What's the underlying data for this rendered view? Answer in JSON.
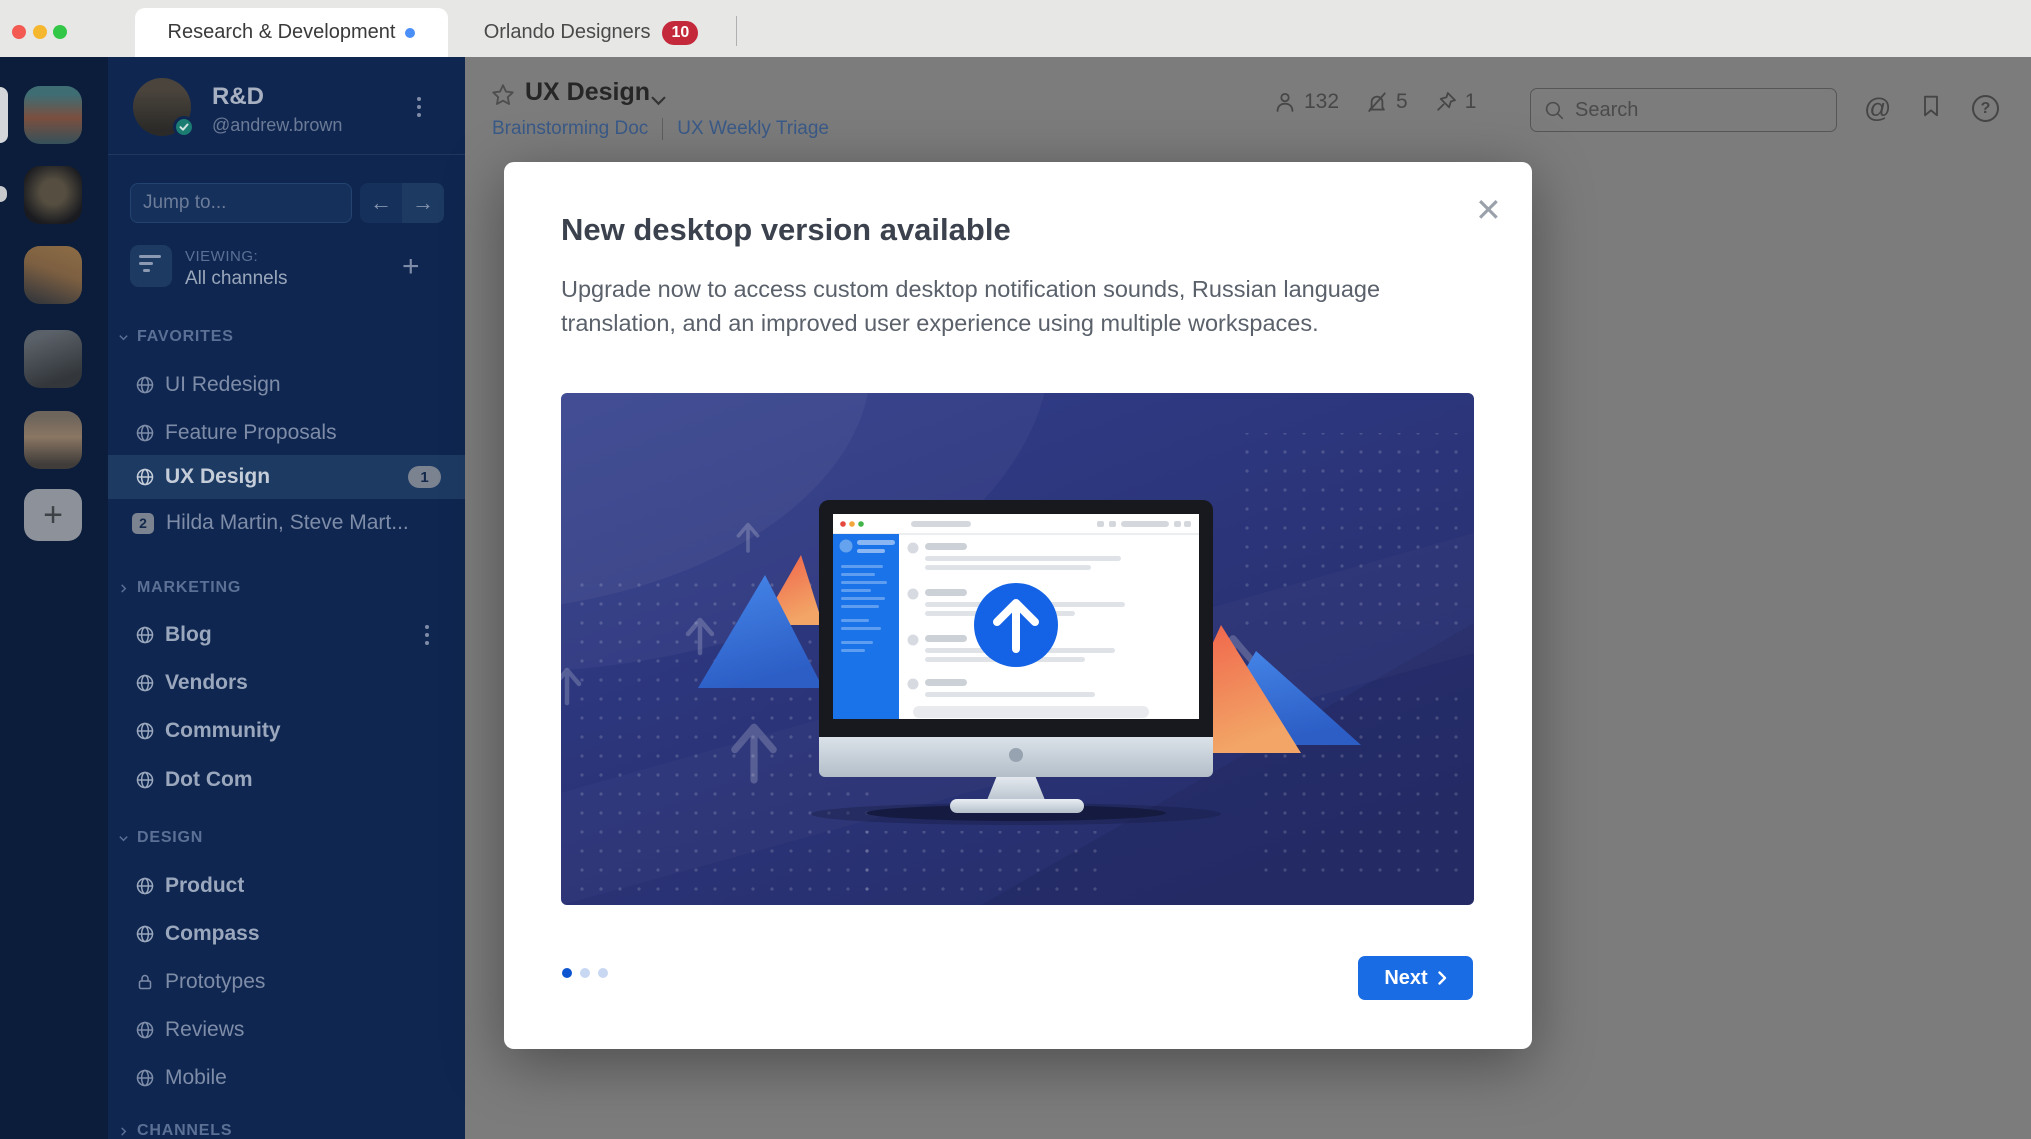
{
  "colors": {
    "tabbar_bg": "#e7e7e6",
    "tab_active_bg": "#ffffff",
    "tab_badge": "#c4293b",
    "tab_dot": "#4a8ff7",
    "rail_bg": "#0b1d3a",
    "sidebar_bg": "#0f2750",
    "row_selected": "#1d3a63",
    "dim_bg": "#7c7c7c",
    "accent_blue": "#1a6ce4",
    "dot_active": "#0d55d0",
    "dot_inactive": "#c8d8f3",
    "check_teal": "#1b7c72",
    "badge_bg": "#7b8290",
    "hdr_link": "#3a5a88",
    "modal_title": "#3b424e",
    "modal_body": "#5a616b"
  },
  "window": {
    "tabs": [
      {
        "label": "Research & Development"
      },
      {
        "label": "Orlando Designers",
        "badge": "10"
      }
    ]
  },
  "rail": {
    "add_label": "+"
  },
  "sidebar": {
    "workspace_name": "R&D",
    "user_handle": "@andrew.brown",
    "jump_placeholder": "Jump to...",
    "viewing_label": "VIEWING:",
    "viewing_value": "All channels",
    "sections": [
      {
        "label": "FAVORITES"
      },
      {
        "label": "MARKETING"
      },
      {
        "label": "DESIGN"
      },
      {
        "label": "CHANNELS"
      }
    ],
    "items": {
      "favorites": [
        {
          "label": "UI Redesign"
        },
        {
          "label": "Feature Proposals"
        },
        {
          "label": "UX Design",
          "badge": "1"
        },
        {
          "label": "Hilda Martin, Steve Mart...",
          "badge": "2"
        }
      ],
      "marketing": [
        {
          "label": "Blog"
        },
        {
          "label": "Vendors"
        },
        {
          "label": "Community"
        },
        {
          "label": "Dot Com"
        }
      ],
      "design": [
        {
          "label": "Product"
        },
        {
          "label": "Compass"
        },
        {
          "label": "Prototypes"
        },
        {
          "label": "Reviews"
        },
        {
          "label": "Mobile"
        }
      ]
    }
  },
  "header": {
    "channel_name": "UX Design",
    "breadcrumbs": [
      "Brainstorming Doc",
      "UX Weekly Triage"
    ],
    "members_count": "132",
    "muted_count": "5",
    "pinned_count": "1",
    "search_placeholder": "Search"
  },
  "modal": {
    "title": "New desktop version available",
    "body": "Upgrade now to access custom desktop notification sounds, Russian language translation, and an improved user experience using multiple workspaces.",
    "next_label": "Next"
  }
}
